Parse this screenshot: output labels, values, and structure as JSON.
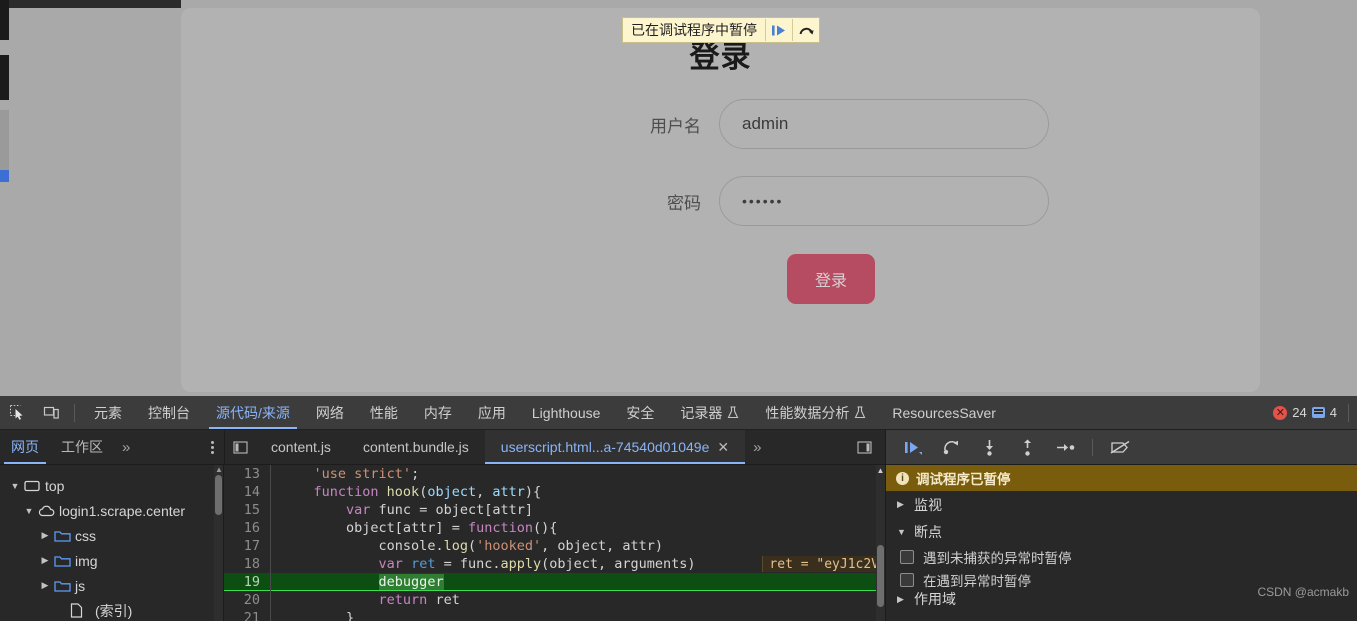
{
  "page": {
    "title": "登录",
    "username_label": "用户名",
    "username_value": "admin",
    "password_label": "密码",
    "password_value": "••••••",
    "login_button": "登录",
    "pause_banner": {
      "text": "已在调试程序中暂停",
      "resume_icon": "resume-script-icon",
      "step_over_icon": "step-over-icon"
    }
  },
  "devtools": {
    "inspect_icon": "inspect-element-icon",
    "device_icon": "device-toolbar-icon",
    "tabs": [
      {
        "label": "元素",
        "active": false
      },
      {
        "label": "控制台",
        "active": false
      },
      {
        "label": "源代码/来源",
        "active": true
      },
      {
        "label": "网络",
        "active": false
      },
      {
        "label": "性能",
        "active": false
      },
      {
        "label": "内存",
        "active": false
      },
      {
        "label": "应用",
        "active": false
      },
      {
        "label": "Lighthouse",
        "active": false
      },
      {
        "label": "安全",
        "active": false
      },
      {
        "label": "记录器",
        "active": false,
        "icon": "flask-icon"
      },
      {
        "label": "性能数据分析",
        "active": false,
        "icon": "flask-icon"
      },
      {
        "label": "ResourcesSaver",
        "active": false
      }
    ],
    "status": {
      "error_count": "24",
      "message_count": "4",
      "error_color": "#e4534a",
      "message_color": "#7aa7f0"
    },
    "nav_tabs": [
      {
        "label": "网页",
        "active": true
      },
      {
        "label": "工作区",
        "active": false
      }
    ],
    "nav_overflow": "»",
    "file_tabs": [
      {
        "label": "content.js",
        "active": false,
        "closable": false
      },
      {
        "label": "content.bundle.js",
        "active": false,
        "closable": false
      },
      {
        "label": "userscript.html...a-74540d01049e",
        "active": true,
        "closable": true
      }
    ],
    "file_overflow": "»",
    "tree": [
      {
        "label": "top",
        "indent": 0,
        "twisty": "▼",
        "icon": "frame-icon"
      },
      {
        "label": "login1.scrape.center",
        "indent": 1,
        "twisty": "▼",
        "icon": "cloud-icon"
      },
      {
        "label": "css",
        "indent": 2,
        "twisty": "▶",
        "icon": "folder-icon"
      },
      {
        "label": "img",
        "indent": 2,
        "twisty": "▶",
        "icon": "folder-icon"
      },
      {
        "label": "js",
        "indent": 2,
        "twisty": "▶",
        "icon": "folder-icon"
      },
      {
        "label": "(索引)",
        "indent": 3,
        "twisty": "",
        "icon": "document-icon"
      }
    ],
    "debugger_controls": [
      {
        "name": "resume-button",
        "icon": "resume-icon"
      },
      {
        "name": "step-over-button",
        "icon": "step-over-icon"
      },
      {
        "name": "step-into-button",
        "icon": "step-into-icon"
      },
      {
        "name": "step-out-button",
        "icon": "step-out-icon"
      },
      {
        "name": "step-button",
        "icon": "step-icon"
      },
      {
        "name": "deactivate-breakpoints-button",
        "icon": "deactivate-breakpoints-icon"
      }
    ],
    "sidebar": {
      "paused_text": "调试程序已暂停",
      "watch_label": "监视",
      "watch_twisty": "▶",
      "breakpoints_label": "断点",
      "breakpoints_twisty": "▼",
      "checkboxes": [
        {
          "label": "遇到未捕获的异常时暂停",
          "checked": false
        },
        {
          "label": "在遇到异常时暂停",
          "checked": false
        }
      ],
      "scope_label": "作用域"
    },
    "inline_value": "ret = \"eyJ1c2V",
    "watermark": "CSDN @acmakb"
  },
  "code": {
    "lines": [
      {
        "num": "13",
        "indent": 4,
        "tokens": [
          {
            "t": "'use strict'",
            "c": "str"
          },
          {
            "t": ";",
            "c": "plain"
          }
        ]
      },
      {
        "num": "14",
        "indent": 4,
        "tokens": [
          {
            "t": "function ",
            "c": "kw"
          },
          {
            "t": "hook",
            "c": "fn"
          },
          {
            "t": "(",
            "c": "plain"
          },
          {
            "t": "object",
            "c": "param"
          },
          {
            "t": ", ",
            "c": "plain"
          },
          {
            "t": "attr",
            "c": "param"
          },
          {
            "t": "){",
            "c": "plain"
          }
        ]
      },
      {
        "num": "15",
        "indent": 8,
        "tokens": [
          {
            "t": "var ",
            "c": "kw"
          },
          {
            "t": "func",
            "c": "plain"
          },
          {
            "t": " = object[attr]",
            "c": "plain"
          }
        ]
      },
      {
        "num": "16",
        "indent": 8,
        "tokens": [
          {
            "t": "object[attr] = ",
            "c": "plain"
          },
          {
            "t": "function",
            "c": "kw"
          },
          {
            "t": "(){",
            "c": "plain"
          }
        ]
      },
      {
        "num": "17",
        "indent": 12,
        "tokens": [
          {
            "t": "console.",
            "c": "plain"
          },
          {
            "t": "log",
            "c": "fn"
          },
          {
            "t": "(",
            "c": "plain"
          },
          {
            "t": "'hooked'",
            "c": "str"
          },
          {
            "t": ", object, attr)",
            "c": "plain"
          }
        ]
      },
      {
        "num": "18",
        "indent": 12,
        "tokens": [
          {
            "t": "var ",
            "c": "kw"
          },
          {
            "t": "ret",
            "c": "kw2"
          },
          {
            "t": " = func.",
            "c": "plain"
          },
          {
            "t": "apply",
            "c": "fn"
          },
          {
            "t": "(object, arguments)",
            "c": "plain"
          }
        ]
      },
      {
        "num": "19",
        "indent": 12,
        "exec": true,
        "tokens": [
          {
            "t": "debugger",
            "c": "dbg-word"
          }
        ]
      },
      {
        "num": "20",
        "indent": 12,
        "tokens": [
          {
            "t": "return ",
            "c": "kw"
          },
          {
            "t": "ret",
            "c": "plain"
          }
        ]
      },
      {
        "num": "21",
        "indent": 8,
        "tokens": [
          {
            "t": "}",
            "c": "plain"
          }
        ]
      }
    ]
  }
}
